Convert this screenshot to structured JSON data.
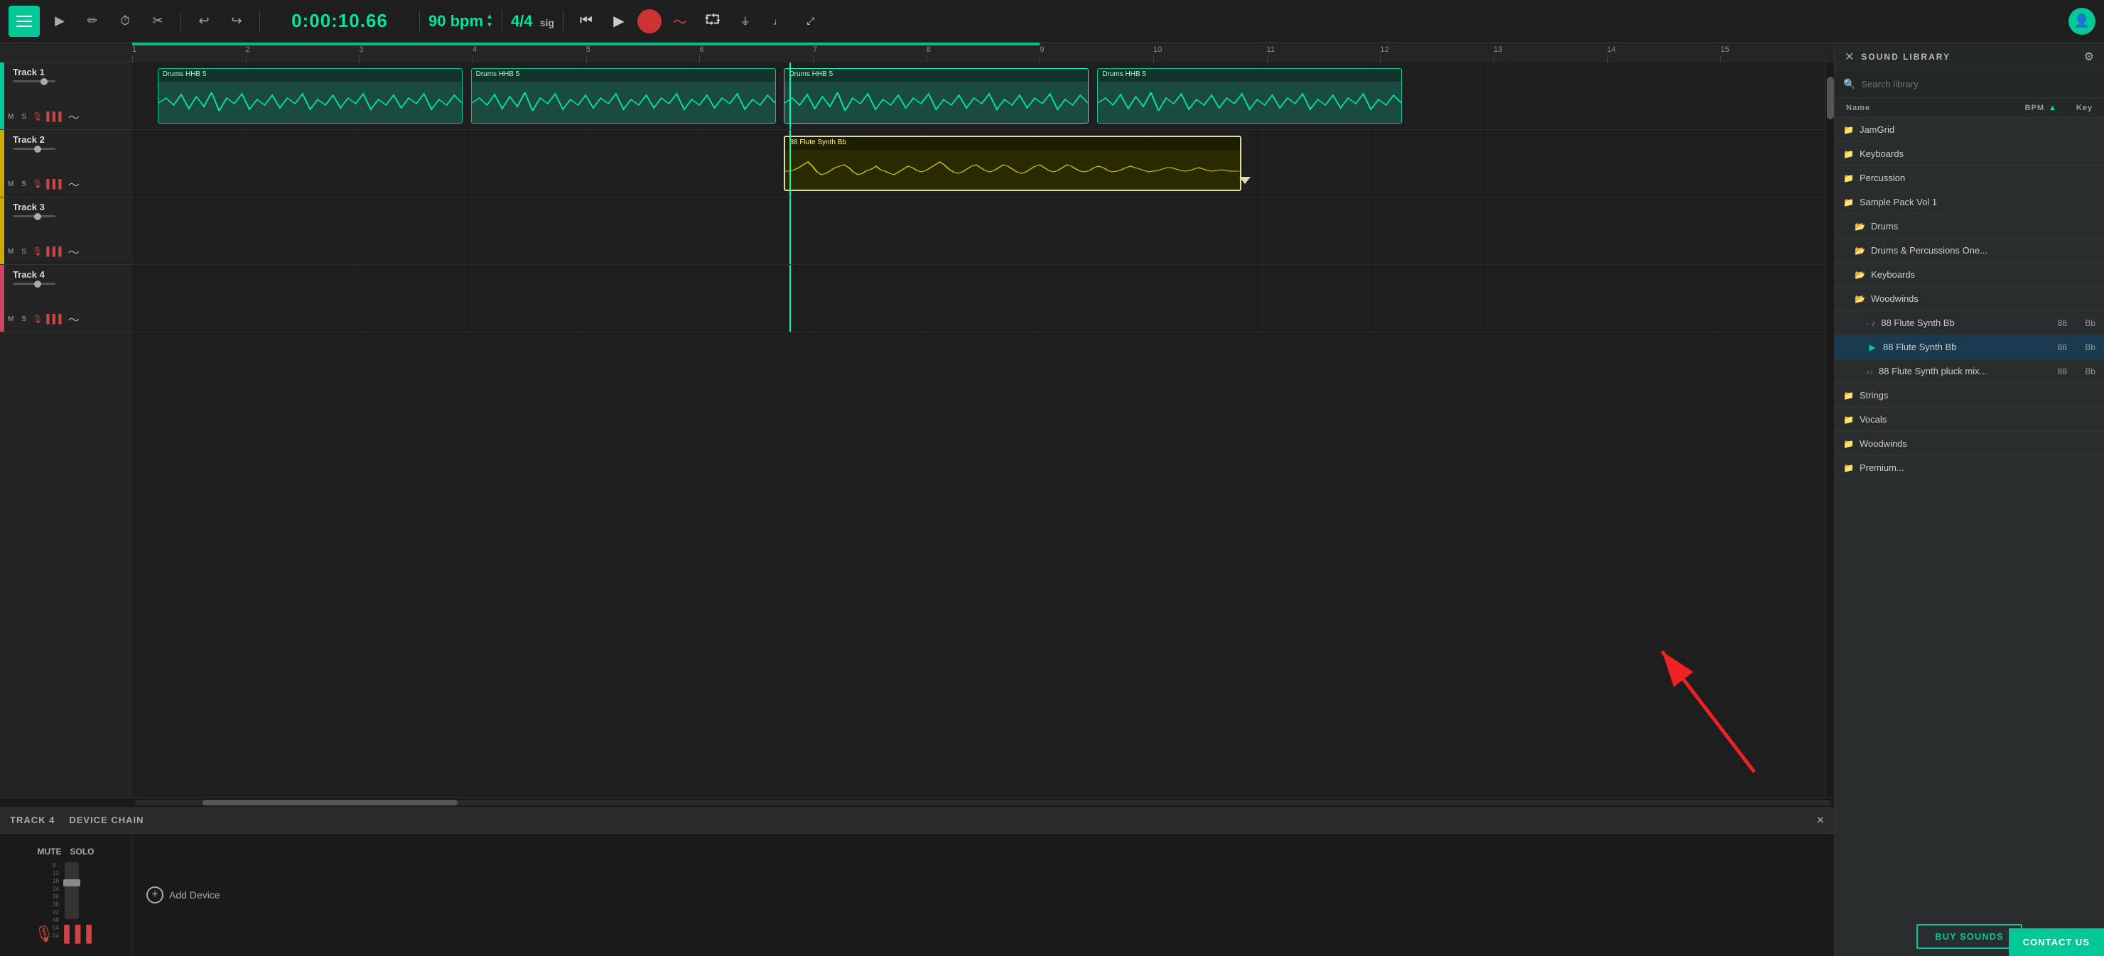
{
  "toolbar": {
    "time": "0:00:10.66",
    "bpm": "90 bpm",
    "sig": "4/4",
    "sig_label": "sig",
    "menu_label": "Menu"
  },
  "tracks": [
    {
      "id": "track1",
      "name": "Track 1",
      "color": "#00c896",
      "clips": [
        {
          "label": "Drums HHB 5",
          "type": "teal",
          "left_pct": 1.5,
          "width_pct": 18
        },
        {
          "label": "Drums HHB 5",
          "type": "teal",
          "left_pct": 20.5,
          "width_pct": 18
        },
        {
          "label": "Drums HHB 5",
          "type": "teal",
          "left_pct": 39,
          "width_pct": 18
        },
        {
          "label": "Drums HHB 5",
          "type": "teal",
          "left_pct": 57.5,
          "width_pct": 18
        }
      ]
    },
    {
      "id": "track2",
      "name": "Track 2",
      "color": "#ccaa00",
      "clips": [
        {
          "label": "88 Flute Synth Bb",
          "type": "yellow",
          "left_pct": 39,
          "width_pct": 30
        }
      ]
    },
    {
      "id": "track3",
      "name": "Track 3",
      "color": "#ccaa00",
      "clips": []
    },
    {
      "id": "track4",
      "name": "Track 4",
      "color": "#cc4466",
      "clips": []
    }
  ],
  "device_chain": {
    "title": "TRACK 4",
    "chain_label": "DEVICE CHAIN",
    "add_device_label": "Add Device",
    "mute_label": "MUTE",
    "solo_label": "SOLO",
    "close_label": "×"
  },
  "sound_library": {
    "title": "SOUND LIBRARY",
    "search_placeholder": "Search library",
    "col_name": "Name",
    "col_bpm": "BPM",
    "col_key": "Key",
    "items": [
      {
        "id": "jamgrid",
        "label": "JamGrid",
        "type": "folder",
        "indent": 0,
        "bpm": "",
        "key": ""
      },
      {
        "id": "keyboards-top",
        "label": "Keyboards",
        "type": "folder",
        "indent": 0,
        "bpm": "",
        "key": ""
      },
      {
        "id": "percussion",
        "label": "Percussion",
        "type": "folder",
        "indent": 0,
        "bpm": "",
        "key": ""
      },
      {
        "id": "sample-pack",
        "label": "Sample Pack Vol 1",
        "type": "folder",
        "indent": 0,
        "bpm": "",
        "key": ""
      },
      {
        "id": "drums",
        "label": "Drums",
        "type": "subfolder",
        "indent": 1,
        "bpm": "",
        "key": ""
      },
      {
        "id": "drums-perc",
        "label": "Drums & Percussions One...",
        "type": "subfolder",
        "indent": 1,
        "bpm": "",
        "key": ""
      },
      {
        "id": "keyboards-sub",
        "label": "Keyboards",
        "type": "subfolder",
        "indent": 1,
        "bpm": "",
        "key": ""
      },
      {
        "id": "woodwinds-sub",
        "label": "Woodwinds",
        "type": "subfolder",
        "indent": 1,
        "bpm": "",
        "key": ""
      },
      {
        "id": "flute-bb-inactive",
        "label": "88 Flute Synth Bb",
        "type": "file-inactive",
        "indent": 2,
        "bpm": "88",
        "key": "Bb"
      },
      {
        "id": "flute-bb-active",
        "label": "88 Flute Synth Bb",
        "type": "file-active",
        "indent": 2,
        "bpm": "88",
        "key": "Bb"
      },
      {
        "id": "flute-pluck",
        "label": "88 Flute Synth pluck mix...",
        "type": "file",
        "indent": 2,
        "bpm": "88",
        "key": "Bb"
      },
      {
        "id": "strings",
        "label": "Strings",
        "type": "folder",
        "indent": 0,
        "bpm": "",
        "key": ""
      },
      {
        "id": "vocals",
        "label": "Vocals",
        "type": "folder",
        "indent": 0,
        "bpm": "",
        "key": ""
      },
      {
        "id": "woodwinds",
        "label": "Woodwinds",
        "type": "folder",
        "indent": 0,
        "bpm": "",
        "key": ""
      },
      {
        "id": "premium",
        "label": "Premium...",
        "type": "folder",
        "indent": 0,
        "bpm": "",
        "key": ""
      }
    ],
    "buy_sounds_label": "BUY SOUNDS",
    "contact_us_label": "CONTACT US"
  },
  "timeline": {
    "markers": [
      "1",
      "2",
      "3",
      "4",
      "5",
      "6",
      "7",
      "8",
      "9",
      "10",
      "11",
      "12",
      "13",
      "14",
      "15"
    ]
  }
}
